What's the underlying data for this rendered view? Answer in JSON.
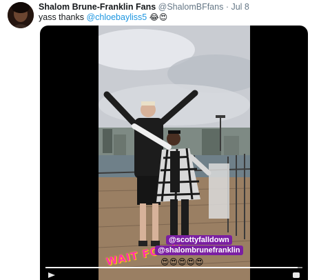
{
  "tweet": {
    "author_name": "Shalom Brune-Franklin Fans",
    "handle": "@ShalomBFfans",
    "separator": "·",
    "date": "Jul 8",
    "text_prefix": "yass thanks ",
    "mention": "@chloebayliss5",
    "emojis": "😂😍"
  },
  "video": {
    "stickers": {
      "gif_text": "WAIT FOR IT",
      "mention_1": "@scottyfalldown",
      "mention_2": "@shalombrunefranklin",
      "emoji_row": "😍😍😍😍😍"
    },
    "progress": 0.98
  },
  "colors": {
    "link": "#1b95e0",
    "sticker_bg": "#7a1fa2",
    "gif_pink": "#ff2fb4"
  }
}
